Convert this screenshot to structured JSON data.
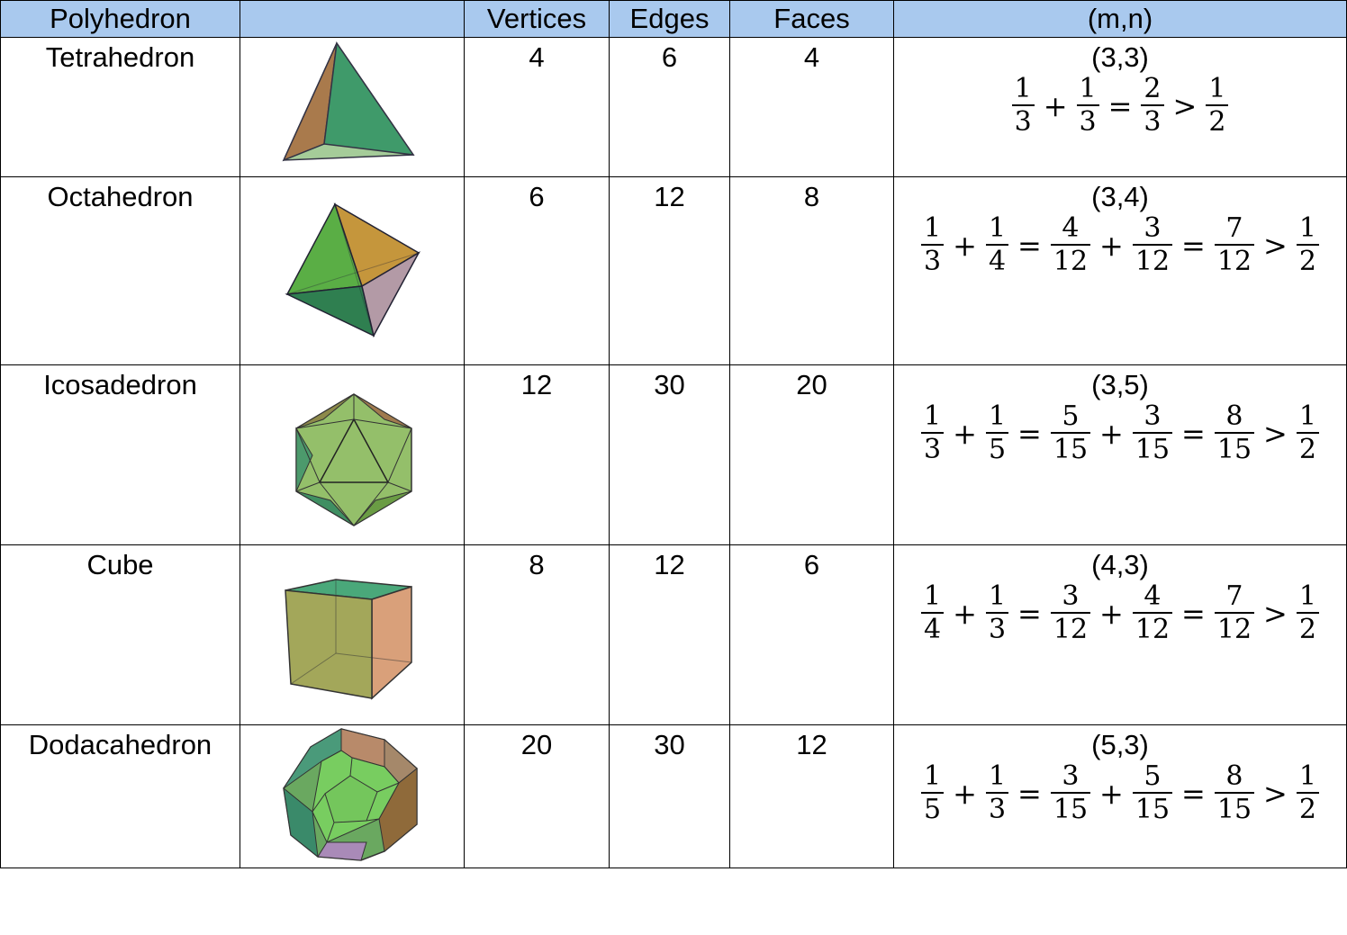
{
  "headers": [
    "Polyhedron",
    "",
    "Vertices",
    "Edges",
    "Faces",
    "(m,n)"
  ],
  "rows": [
    {
      "name": "Tetrahedron",
      "vertices": "4",
      "edges": "6",
      "faces": "4",
      "mn": "(3,3)",
      "eq": [
        {
          "n": "1",
          "d": "3"
        },
        "+",
        {
          "n": "1",
          "d": "3"
        },
        "=",
        {
          "n": "2",
          "d": "3"
        },
        ">",
        {
          "n": "1",
          "d": "2"
        }
      ]
    },
    {
      "name": "Octahedron",
      "vertices": "6",
      "edges": "12",
      "faces": "8",
      "mn": "(3,4)",
      "eq": [
        {
          "n": "1",
          "d": "3"
        },
        "+",
        {
          "n": "1",
          "d": "4"
        },
        "=",
        {
          "n": "4",
          "d": "12"
        },
        "+",
        {
          "n": "3",
          "d": "12"
        },
        "=",
        {
          "n": "7",
          "d": "12"
        },
        ">",
        {
          "n": "1",
          "d": "2"
        }
      ]
    },
    {
      "name": "Icosadedron",
      "vertices": "12",
      "edges": "30",
      "faces": "20",
      "mn": "(3,5)",
      "eq": [
        {
          "n": "1",
          "d": "3"
        },
        "+",
        {
          "n": "1",
          "d": "5"
        },
        "=",
        {
          "n": "5",
          "d": "15"
        },
        "+",
        {
          "n": "3",
          "d": "15"
        },
        "=",
        {
          "n": "8",
          "d": "15"
        },
        ">",
        {
          "n": "1",
          "d": "2"
        }
      ]
    },
    {
      "name": "Cube",
      "vertices": "8",
      "edges": "12",
      "faces": "6",
      "mn": "(4,3)",
      "eq": [
        {
          "n": "1",
          "d": "4"
        },
        "+",
        {
          "n": "1",
          "d": "3"
        },
        "=",
        {
          "n": "3",
          "d": "12"
        },
        "+",
        {
          "n": "4",
          "d": "12"
        },
        "=",
        {
          "n": "7",
          "d": "12"
        },
        ">",
        {
          "n": "1",
          "d": "2"
        }
      ]
    },
    {
      "name": "Dodacahedron",
      "vertices": "20",
      "edges": "30",
      "faces": "12",
      "mn": "(5,3)",
      "eq": [
        {
          "n": "1",
          "d": "5"
        },
        "+",
        {
          "n": "1",
          "d": "3"
        },
        "=",
        {
          "n": "3",
          "d": "15"
        },
        "+",
        {
          "n": "5",
          "d": "15"
        },
        "=",
        {
          "n": "8",
          "d": "15"
        },
        ">",
        {
          "n": "1",
          "d": "2"
        }
      ]
    }
  ],
  "colors": {
    "header_bg": "#a9c9ee",
    "solid_green": "#3fa86a",
    "solid_orange": "#c58a4e"
  }
}
